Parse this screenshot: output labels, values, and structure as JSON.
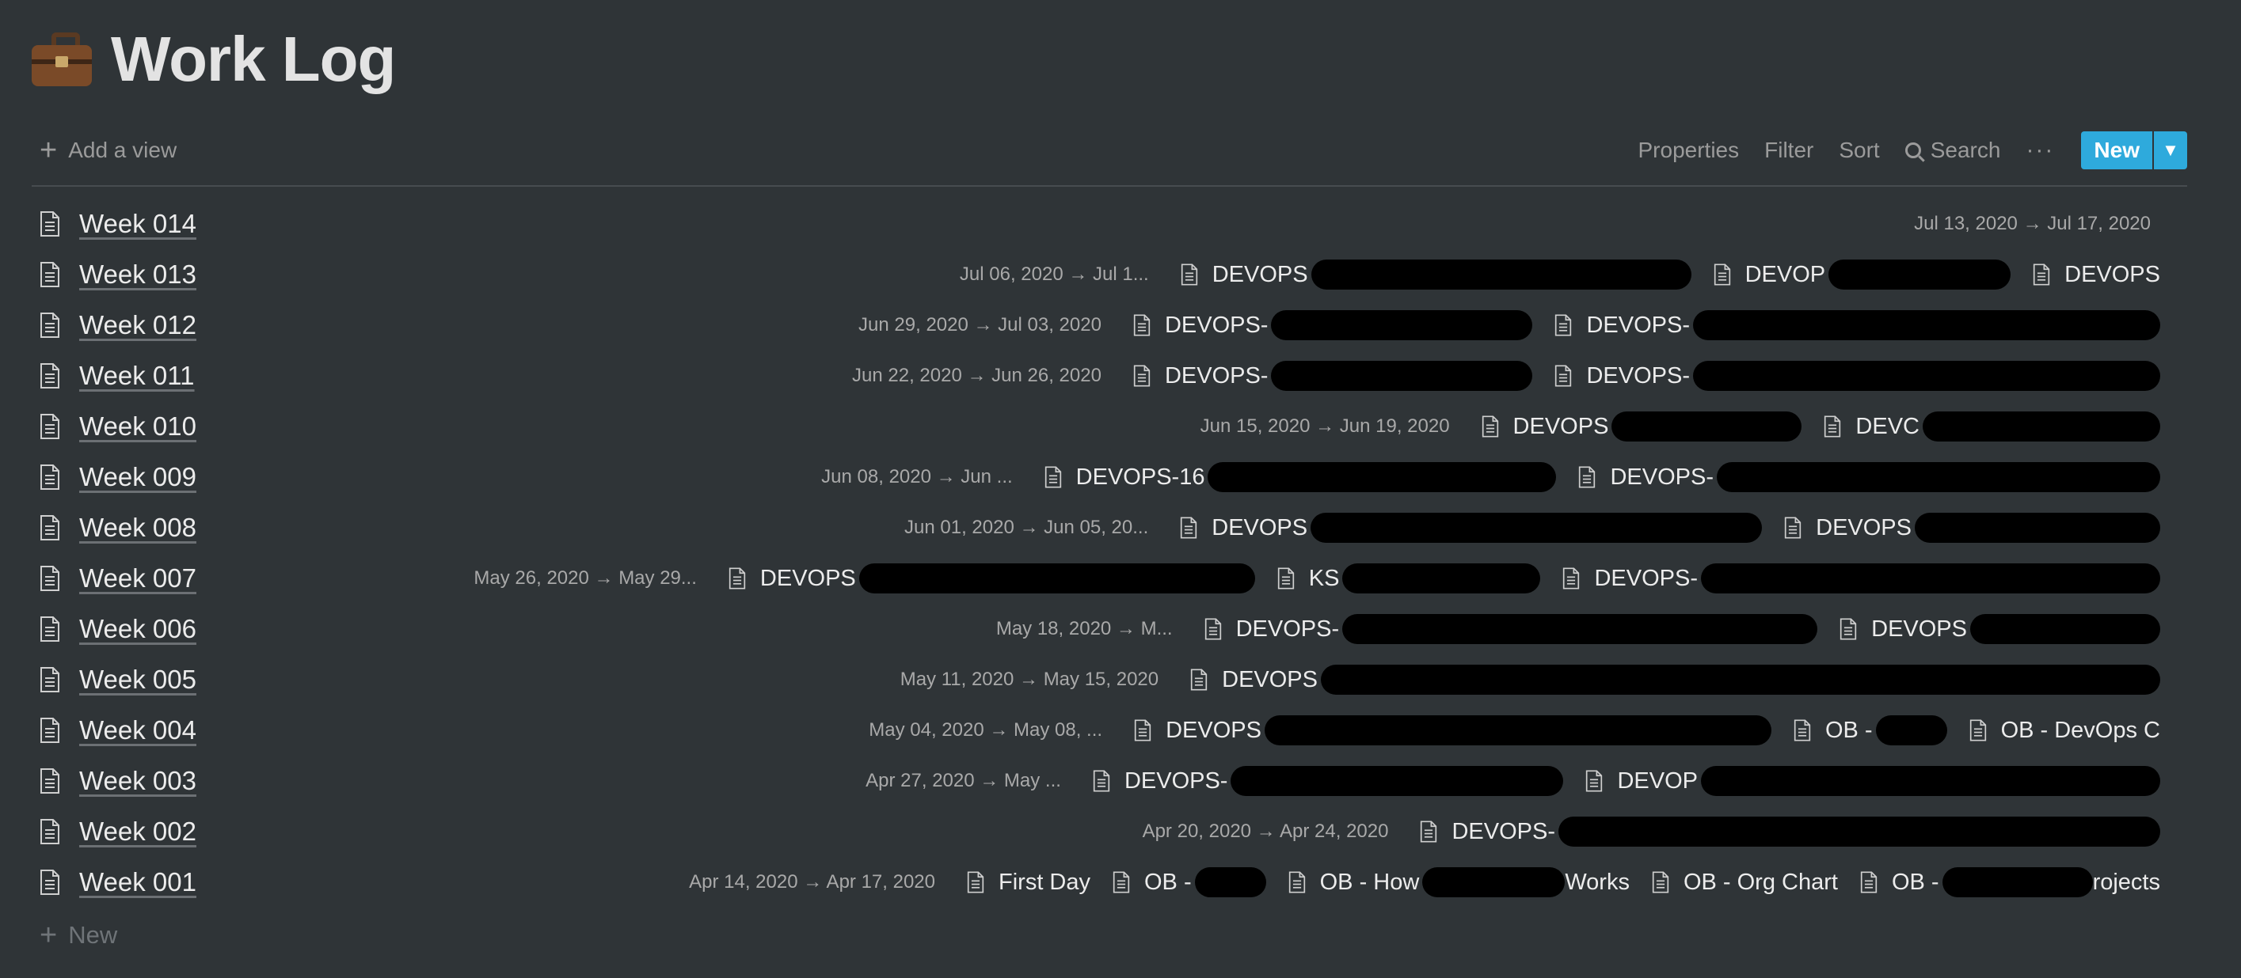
{
  "header": {
    "title": "Work Log",
    "icon": "briefcase-icon"
  },
  "toolbar": {
    "add_view": "Add a view",
    "properties": "Properties",
    "filter": "Filter",
    "sort": "Sort",
    "search": "Search",
    "more": "···",
    "new": "New"
  },
  "rows": [
    {
      "name": "Week 014",
      "date": "Jul 13, 2020 → Jul 17, 2020",
      "pages": []
    },
    {
      "name": "Week 013",
      "date": "Jul 06, 2020 → Jul 1...",
      "pages": [
        "DEVOPS",
        "DEVOP",
        "DEVOPS"
      ]
    },
    {
      "name": "Week 012",
      "date": "Jun 29, 2020 → Jul 03, 2020",
      "pages": [
        "DEVOPS-",
        "DEVOPS-"
      ]
    },
    {
      "name": "Week 011",
      "date": "Jun 22, 2020 → Jun 26, 2020",
      "pages": [
        "DEVOPS-",
        "DEVOPS-"
      ]
    },
    {
      "name": "Week 010",
      "date": "Jun 15, 2020 → Jun 19, 2020",
      "pages": [
        "DEVOPS",
        "DEVC"
      ]
    },
    {
      "name": "Week 009",
      "date": "Jun 08, 2020 → Jun ...",
      "pages": [
        "DEVOPS-16",
        "DEVOPS-"
      ]
    },
    {
      "name": "Week 008",
      "date": "Jun 01, 2020 → Jun 05, 20...",
      "pages": [
        "DEVOPS",
        "DEVOPS"
      ]
    },
    {
      "name": "Week 007",
      "date": "May 26, 2020 → May 29...",
      "pages": [
        "DEVOPS",
        "KS",
        "DEVOPS-"
      ]
    },
    {
      "name": "Week 006",
      "date": "May 18, 2020 → M...",
      "pages": [
        "DEVOPS-",
        "DEVOPS"
      ]
    },
    {
      "name": "Week 005",
      "date": "May 11, 2020 → May 15, 2020",
      "pages": [
        "DEVOPS"
      ]
    },
    {
      "name": "Week 004",
      "date": "May 04, 2020 → May 08, ...",
      "pages": [
        "DEVOPS",
        "OB -",
        "OB - DevOps C"
      ]
    },
    {
      "name": "Week 003",
      "date": "Apr 27, 2020 → May ...",
      "pages": [
        "DEVOPS-",
        "DEVOP"
      ]
    },
    {
      "name": "Week 002",
      "date": "Apr 20, 2020 → Apr 24, 2020",
      "pages": [
        "DEVOPS-"
      ]
    },
    {
      "name": "Week 001",
      "date": "Apr 14, 2020 → Apr 17, 2020",
      "pages": [
        "First Day",
        "OB -",
        "OB - How",
        "OB - Org Chart",
        "OB -"
      ],
      "tails": [
        "Works",
        "rojects"
      ]
    }
  ],
  "new_row": "New"
}
